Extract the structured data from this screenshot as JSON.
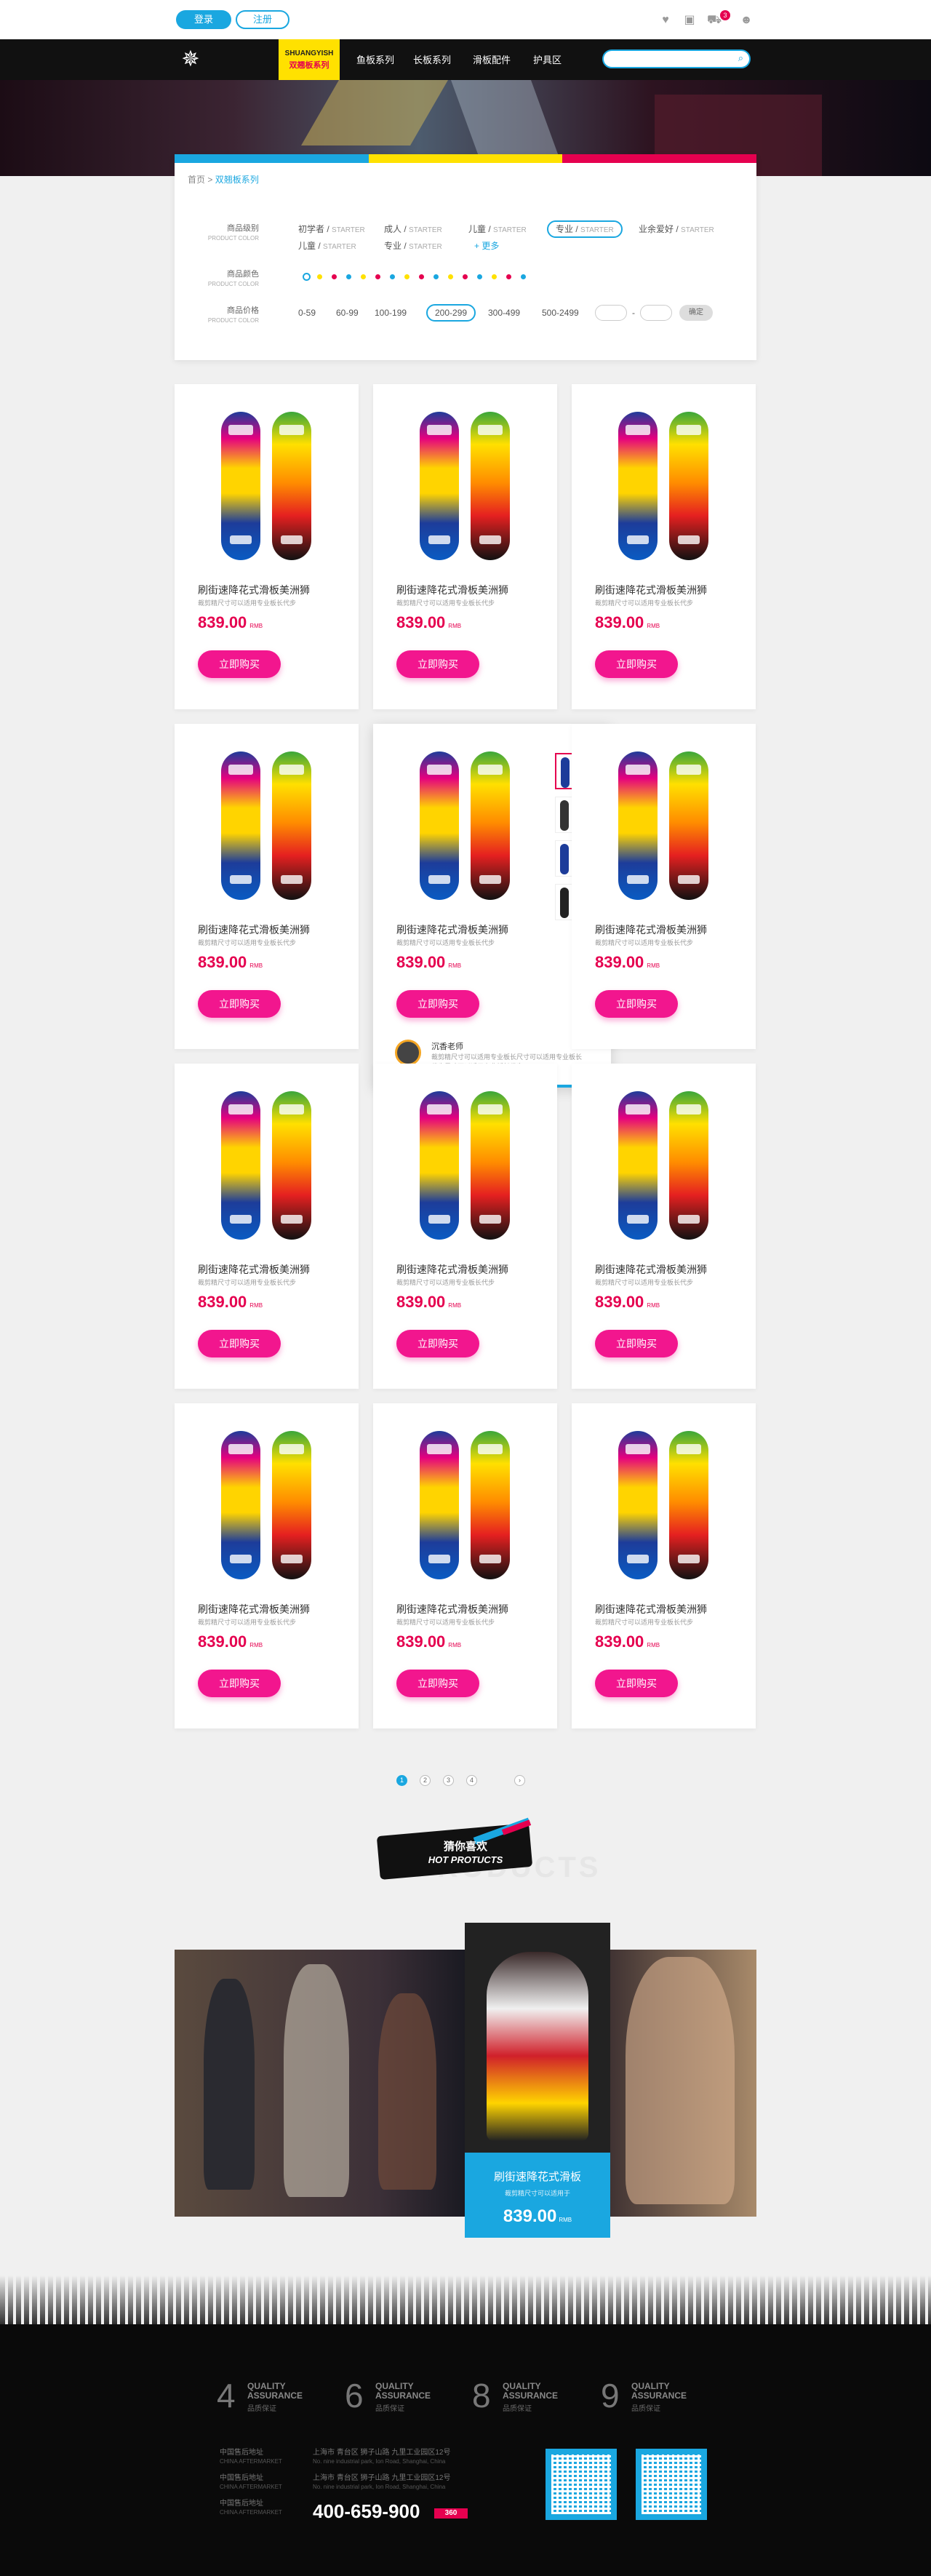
{
  "topbar": {
    "login": "登录",
    "register": "注册",
    "cart_count": "3"
  },
  "nav": {
    "brand_en": "SHUANGYISH",
    "brand_cn": "双翘板系列",
    "items": [
      "鱼板系列",
      "长板系列",
      "滑板配件",
      "护具区"
    ]
  },
  "breadcrumb": {
    "home": "首页",
    "current": "双翘板系列"
  },
  "filters": {
    "level_label": "商品级别",
    "level_label_en": "PRODUCT COLOR",
    "level_options": [
      {
        "cn": "初学者",
        "en": "STARTER"
      },
      {
        "cn": "成人",
        "en": "STARTER"
      },
      {
        "cn": "儿童",
        "en": "STARTER"
      },
      {
        "cn": "专业",
        "en": "STARTER"
      },
      {
        "cn": "业余爱好",
        "en": "STARTER"
      },
      {
        "cn": "儿童",
        "en": "STARTER"
      },
      {
        "cn": "专业",
        "en": "STARTER"
      }
    ],
    "more": "+ 更多",
    "color_label": "商品颜色",
    "color_label_en": "PRODUCT COLOR",
    "colors": [
      "#1aa7e0",
      "#ffe100",
      "#e5004f",
      "#1aa7e0",
      "#ffe100",
      "#e5004f",
      "#1aa7e0",
      "#ffe100",
      "#e5004f",
      "#1aa7e0",
      "#ffe100",
      "#e5004f",
      "#1aa7e0",
      "#ffe100",
      "#e5004f",
      "#1aa7e0"
    ],
    "price_label": "商品价格",
    "price_label_en": "PRODUCT COLOR",
    "price_options": [
      "0-59",
      "60-99",
      "100-199",
      "200-299",
      "300-499",
      "500-2499"
    ],
    "price_sep": "-",
    "confirm": "确定"
  },
  "product": {
    "title": "刷街速降花式滑板美洲狮",
    "desc": "裁剪精尺寸可以适用专业板长代步",
    "price": "839.00",
    "unit": "RMB",
    "buy": "立即购买"
  },
  "hover": {
    "teacher": "沉香老师",
    "teacher_desc": "裁剪精尺寸可以适用专业板长尺寸可以适用专业板长代步尺寸可以适用专业板长代步"
  },
  "pagination": [
    "1",
    "2",
    "3",
    "4"
  ],
  "hot": {
    "bg_text": "PRODUCTS",
    "cn": "猜你喜欢",
    "en": "HOT PROTUCTS"
  },
  "promo": {
    "title": "刷街速降花式滑板",
    "sub": "裁剪精尺寸可以适用于",
    "price": "839.00",
    "unit": "RMB"
  },
  "footer": {
    "assurances": [
      {
        "num": "4",
        "en1": "QUALITY",
        "en2": "ASSURANCE",
        "cn": "品质保证"
      },
      {
        "num": "6",
        "en1": "QUALITY",
        "en2": "ASSURANCE",
        "cn": "品质保证"
      },
      {
        "num": "8",
        "en1": "QUALITY",
        "en2": "ASSURANCE",
        "cn": "品质保证"
      },
      {
        "num": "9",
        "en1": "QUALITY",
        "en2": "ASSURANCE",
        "cn": "品质保证"
      }
    ],
    "addresses": [
      {
        "label": "中国售后地址",
        "label_en": "CHINA AFTERMARKET",
        "cn": "上海市  青台区  狮子山路  九里工业园区12号",
        "en": "No. nine industrial park, Ion Road, Shanghai, China"
      },
      {
        "label": "中国售后地址",
        "label_en": "CHINA AFTERMARKET",
        "cn": "上海市  青台区  狮子山路  九里工业园区12号",
        "en": "No. nine industrial park, Ion Road, Shanghai, China"
      },
      {
        "label": "中国售后地址",
        "label_en": "CHINA AFTERMARKET"
      }
    ],
    "hotline": "400-659-900",
    "small_logo": "360"
  },
  "colors": {
    "accent": "#1aa7e0",
    "pink": "#f2168e",
    "yellow": "#ffe100",
    "magenta": "#e5004f"
  }
}
